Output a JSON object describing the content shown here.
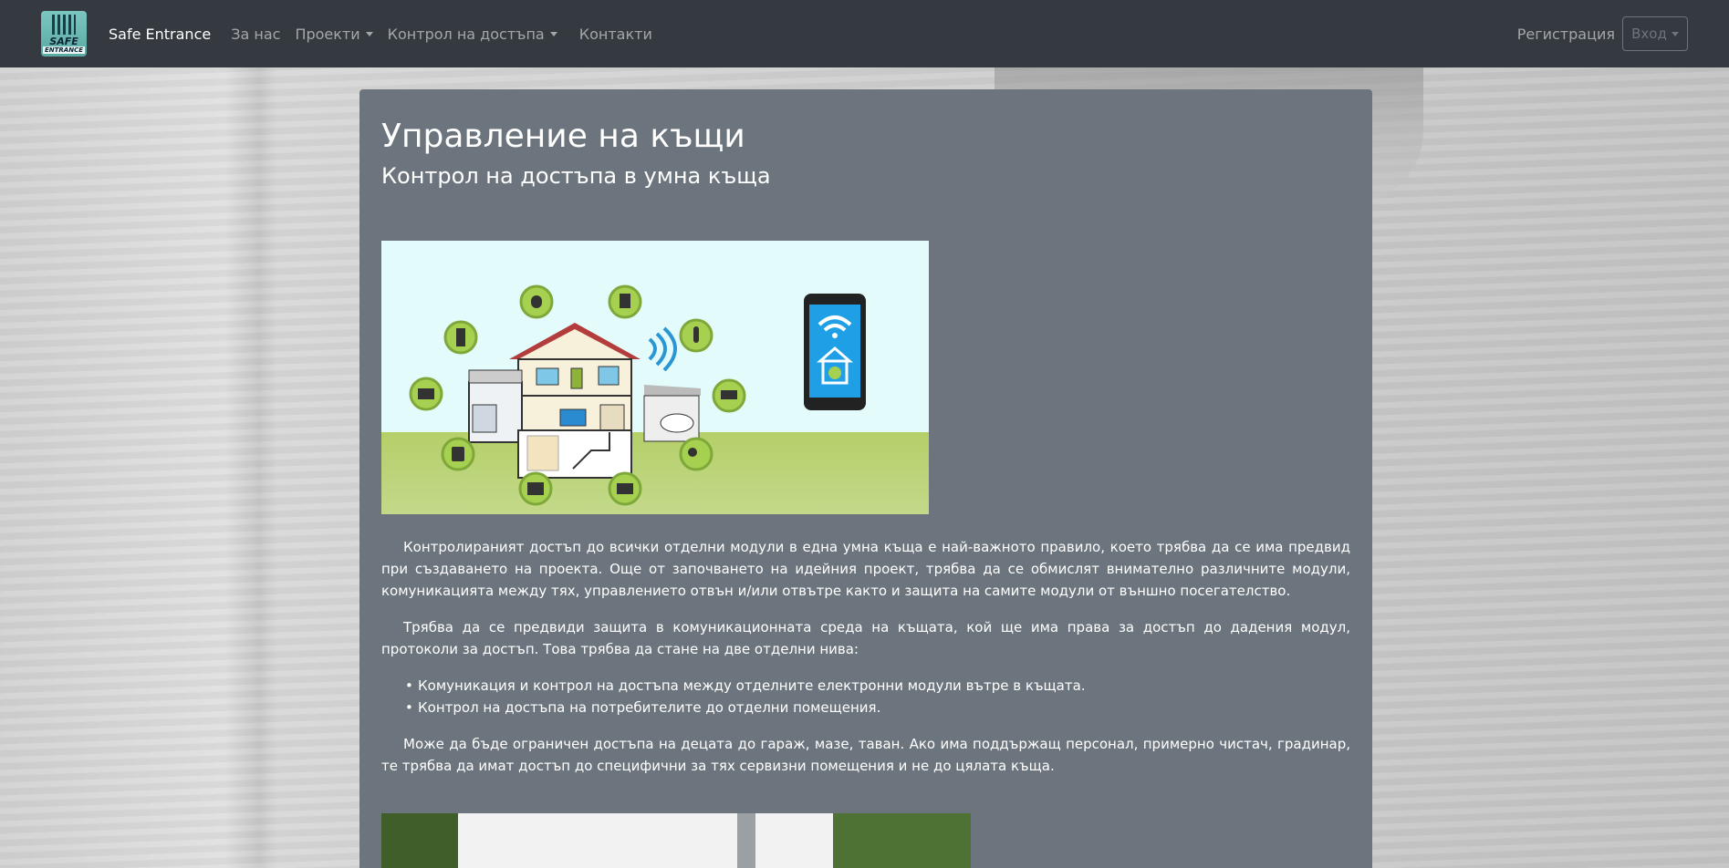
{
  "navbar": {
    "logo_line1": "SAFE",
    "logo_line2": "ENTRANCE",
    "brand": "Safe Entrance",
    "links": [
      {
        "label": "За нас",
        "dropdown": false
      },
      {
        "label": "Проекти",
        "dropdown": true
      },
      {
        "label": "Контрол на достъпа",
        "dropdown": true
      },
      {
        "label": "Контакти",
        "dropdown": false
      }
    ],
    "register": "Регистрация",
    "login": "Вход"
  },
  "main": {
    "title": "Управление на къщи",
    "subtitle": "Контрол на достъпа в умна къща",
    "paragraph1": "Контролираният достъп до всички отделни модули в една умна къща е най-важното правило, което трябва да се има предвид при създаването на проекта. Още от започването на идейния проект, трябва да се обмислят внимателно различните модули, комуникацията между тях, управлението отвън и/или отвътре както и защита на самите модули от външно посегателство.",
    "paragraph2": "Трябва да се предвиди защита в комуникационната среда на къщата, кой ще има права за достъп до дадения модул, протоколи за достъп. Това трябва да стане на две отделни нива:",
    "list": [
      "Комуникация и контрол на достъпа между отделните електронни модули вътре в къщата.",
      "Контрол на достъпа на потребителите до отделни помещения."
    ],
    "paragraph3": "Може да бъде ограничен достъпа на децата до гараж, мазе, таван. Ако има поддържащ персонал, примерно чистач, градинар, те трябва да имат достъп до специфични за тях сервизни помещения и не до цялата къща."
  },
  "colors": {
    "navbar_bg": "#343a40",
    "panel_bg": "#6c757d",
    "hero_sky": "#e4fbfb",
    "hero_ground": "#b5cf69"
  }
}
